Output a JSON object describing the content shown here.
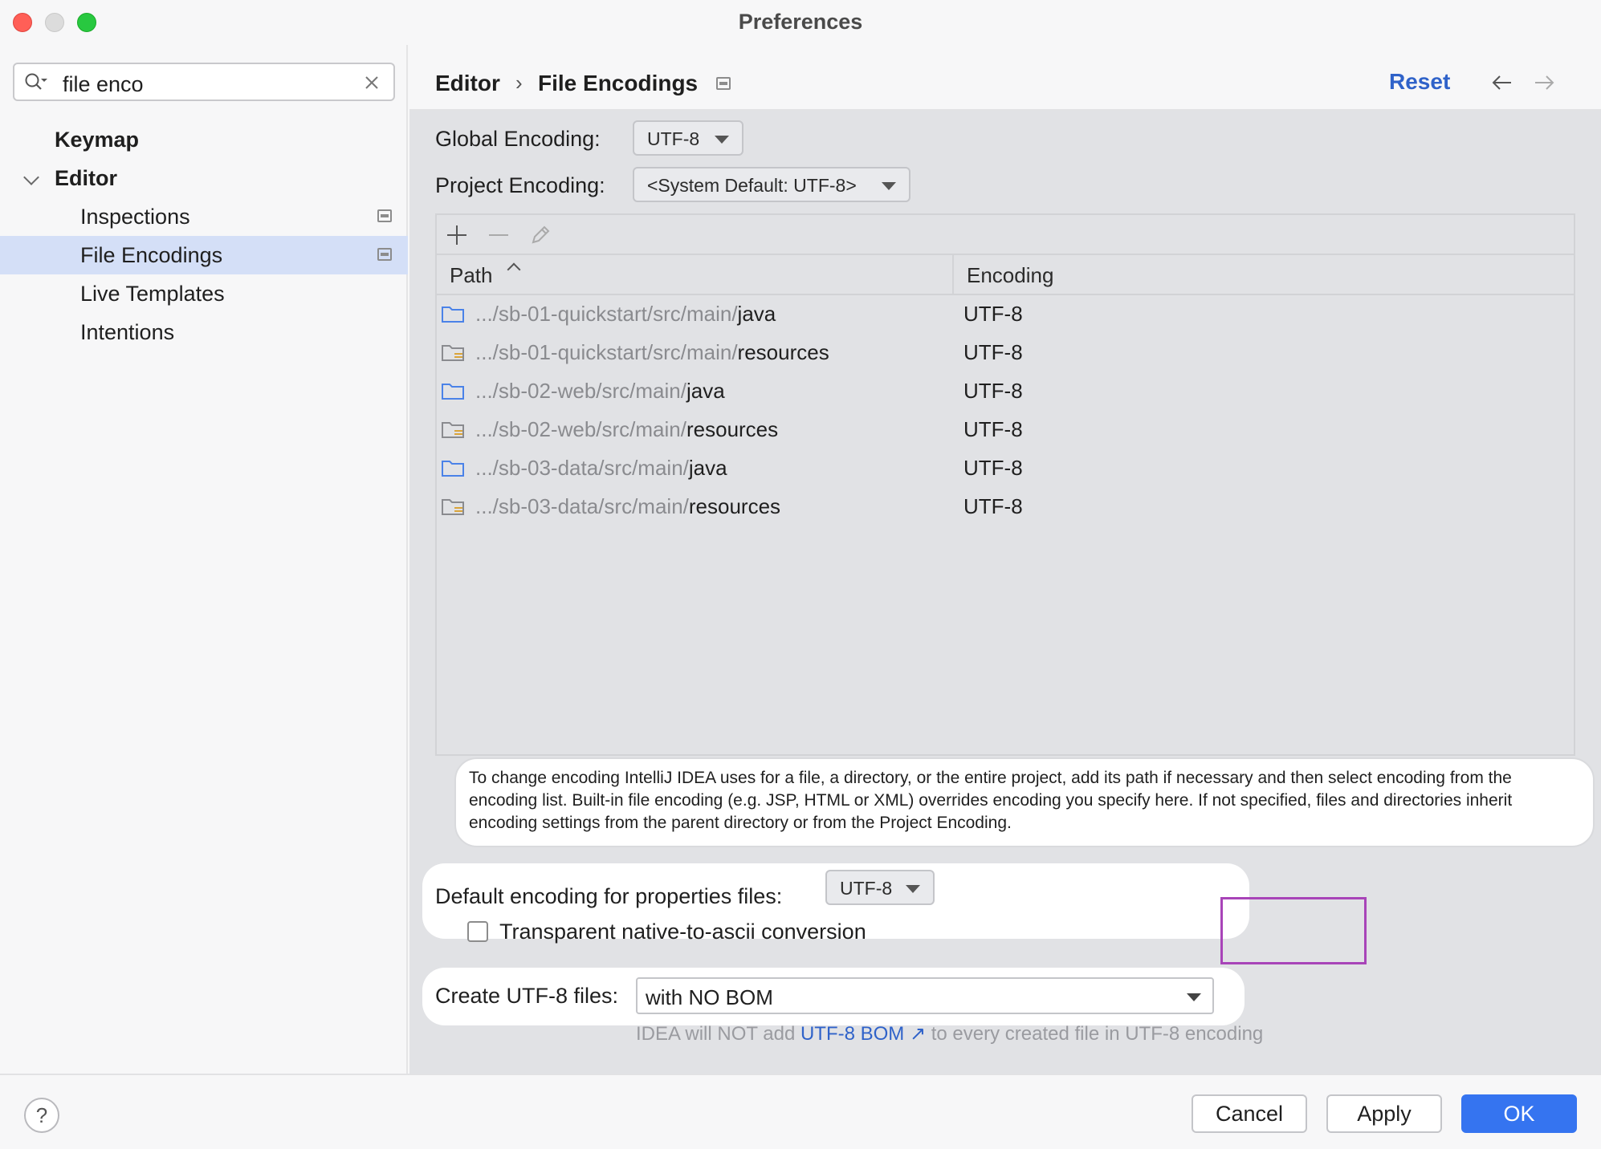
{
  "window": {
    "title": "Preferences"
  },
  "search": {
    "value": "file enco"
  },
  "sidebar": {
    "items": [
      {
        "label": "Keymap"
      },
      {
        "label": "Editor"
      },
      {
        "label": "Inspections"
      },
      {
        "label": "File Encodings"
      },
      {
        "label": "Live Templates"
      },
      {
        "label": "Intentions"
      }
    ]
  },
  "header": {
    "breadcrumb": [
      "Editor",
      "File Encodings"
    ],
    "reset_label": "Reset"
  },
  "settings": {
    "global_encoding_label": "Global Encoding:",
    "global_encoding_value": "UTF-8",
    "project_encoding_label": "Project Encoding:",
    "project_encoding_value": "<System Default: UTF-8>",
    "table": {
      "columns": [
        "Path",
        "Encoding"
      ],
      "rows": [
        {
          "prefix": ".../sb-01-quickstart/src/main/",
          "leaf": "java",
          "encoding": "UTF-8"
        },
        {
          "prefix": ".../sb-01-quickstart/src/main/",
          "leaf": "resources",
          "encoding": "UTF-8"
        },
        {
          "prefix": ".../sb-02-web/src/main/",
          "leaf": "java",
          "encoding": "UTF-8"
        },
        {
          "prefix": ".../sb-02-web/src/main/",
          "leaf": "resources",
          "encoding": "UTF-8"
        },
        {
          "prefix": ".../sb-03-data/src/main/",
          "leaf": "java",
          "encoding": "UTF-8"
        },
        {
          "prefix": ".../sb-03-data/src/main/",
          "leaf": "resources",
          "encoding": "UTF-8"
        }
      ]
    },
    "info_text": "To change encoding IntelliJ IDEA uses for a file, a directory, or the entire project, add its path if necessary and then select encoding from the encoding list. Built-in file encoding (e.g. JSP, HTML or XML) overrides encoding you specify here. If not specified, files and directories inherit encoding settings from the parent directory or from the Project Encoding.",
    "properties_label": "Default encoding for properties files:",
    "properties_value": "UTF-8",
    "native_to_ascii_label": "Transparent native-to-ascii conversion",
    "native_to_ascii_checked": false,
    "create_utf8_label": "Create UTF-8 files:",
    "create_utf8_value": "with NO BOM",
    "hint_before": "IDEA will NOT add",
    "hint_link": "UTF-8 BOM",
    "hint_after": "to every created file in UTF-8 encoding"
  },
  "footer": {
    "help_label": "?",
    "cancel_label": "Cancel",
    "apply_label": "Apply",
    "ok_label": "OK"
  },
  "colors": {
    "accent": "#3574f0",
    "link": "#2f62c9",
    "selection": "#d4dff7",
    "highlight_box": "#a844b8"
  }
}
